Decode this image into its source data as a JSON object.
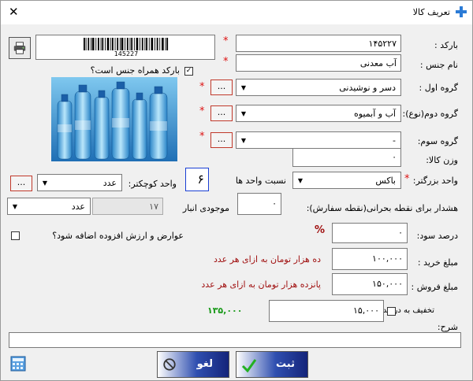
{
  "window": {
    "title": "تعریف کالا",
    "close_glyph": "✕"
  },
  "barcode": {
    "label": "بارکد :",
    "value": "۱۴۵۲۲۷",
    "image_number": "145227"
  },
  "name": {
    "label": "نام جنس :",
    "value": "آب معدنی"
  },
  "barcode_with_name": {
    "label": "بارکد همراه جنس است؟",
    "checked": true
  },
  "group1": {
    "label": "گروه اول :",
    "value": "دسر و نوشیدنی"
  },
  "group2": {
    "label": "گروه دوم(نوع):",
    "value": "آب و آبمیوه"
  },
  "group3": {
    "label": "گروه سوم:",
    "value": "-"
  },
  "weight": {
    "label": "وزن کالا:",
    "value": "۰"
  },
  "big_unit": {
    "label": "واحد بزرگتر:",
    "value": "باکس"
  },
  "unit_ratio": {
    "label": "نسبت واحد ها",
    "value": "۶"
  },
  "small_unit": {
    "label": "واحد کوچکتر:",
    "value": "عدد"
  },
  "critical_warning": {
    "label": "هشدار برای نقطه بحرانی(نقطه سفارش):",
    "value": "۰"
  },
  "stock": {
    "label": "موجودی انبار",
    "value": "۱۷",
    "unit": "عدد"
  },
  "tax": {
    "label": "عوارض و ارزش افزوده اضافه شود؟",
    "checked": false
  },
  "profit": {
    "label": "درصد سود:",
    "value": "۰",
    "percent_sign": "%"
  },
  "buy_price": {
    "label": "مبلغ خرید :",
    "value": "۱۰۰,۰۰۰",
    "words": "ده هزار  تومان  به ازای هر عدد"
  },
  "sell_price": {
    "label": "مبلغ فروش :",
    "value": "۱۵۰,۰۰۰",
    "words": "پانزده هزار  تومان  به ازای هر عدد"
  },
  "discount": {
    "label": "تخفیف به درصد؟",
    "checked": false,
    "value": "۱۵,۰۰۰",
    "result": "۱۳۵,۰۰۰"
  },
  "description": {
    "label": "شرح:",
    "value": ""
  },
  "buttons": {
    "dots": "...",
    "submit": "ثبت",
    "cancel": "لغو"
  },
  "colors": {
    "required": "#dd1111",
    "words": "#a01010",
    "result": "#1a9a1a"
  }
}
